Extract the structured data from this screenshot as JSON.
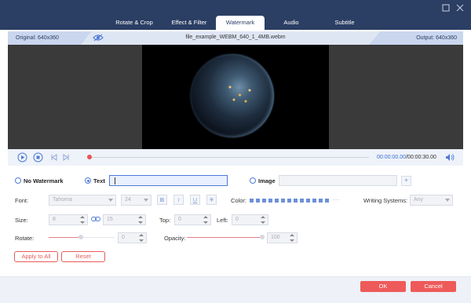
{
  "tabs": [
    {
      "label": "Rotate & Crop"
    },
    {
      "label": "Effect & Filter"
    },
    {
      "label": "Watermark"
    },
    {
      "label": "Audio"
    },
    {
      "label": "Subtitle"
    }
  ],
  "info": {
    "original": "Original: 640x360",
    "filename": "file_example_WEBM_640_1_4MB.webm",
    "output": "Output: 640x360"
  },
  "player": {
    "current_time": "00:00:00.00",
    "total_time": "/00:00:30.00"
  },
  "watermark": {
    "no_watermark_label": "No Watermark",
    "text_label": "Text",
    "text_value": "",
    "image_label": "Image",
    "image_value": "",
    "selected": "Text"
  },
  "style": {
    "font_label": "Font:",
    "font_value": "Tahoma",
    "size_value": "24",
    "bold": "B",
    "italic": "I",
    "underline": "U",
    "strike": "T",
    "color_label": "Color:",
    "more": "···",
    "writing_label": "Writing Systems:",
    "writing_value": "Any"
  },
  "geometry": {
    "size_label": "Size:",
    "width_value": "8",
    "height_value": "15",
    "top_label": "Top:",
    "top_value": "0",
    "left_label": "Left:",
    "left_value": "0",
    "rotate_label": "Rotate:",
    "rotate_value": "0",
    "opacity_label": "Opacity:",
    "opacity_value": "100"
  },
  "actions": {
    "apply_all": "Apply to All",
    "reset": "Reset",
    "ok": "OK",
    "cancel": "Cancel"
  },
  "colors": {
    "accent": "#4f7bd8",
    "titlebar": "#2b3e63",
    "primary_button": "#ee5a5a"
  },
  "icons": [
    "eye-icon",
    "play-icon",
    "stop-icon",
    "prev-icon",
    "next-icon",
    "volume-icon",
    "link-icon",
    "plus-icon",
    "maximize-icon",
    "close-icon"
  ]
}
